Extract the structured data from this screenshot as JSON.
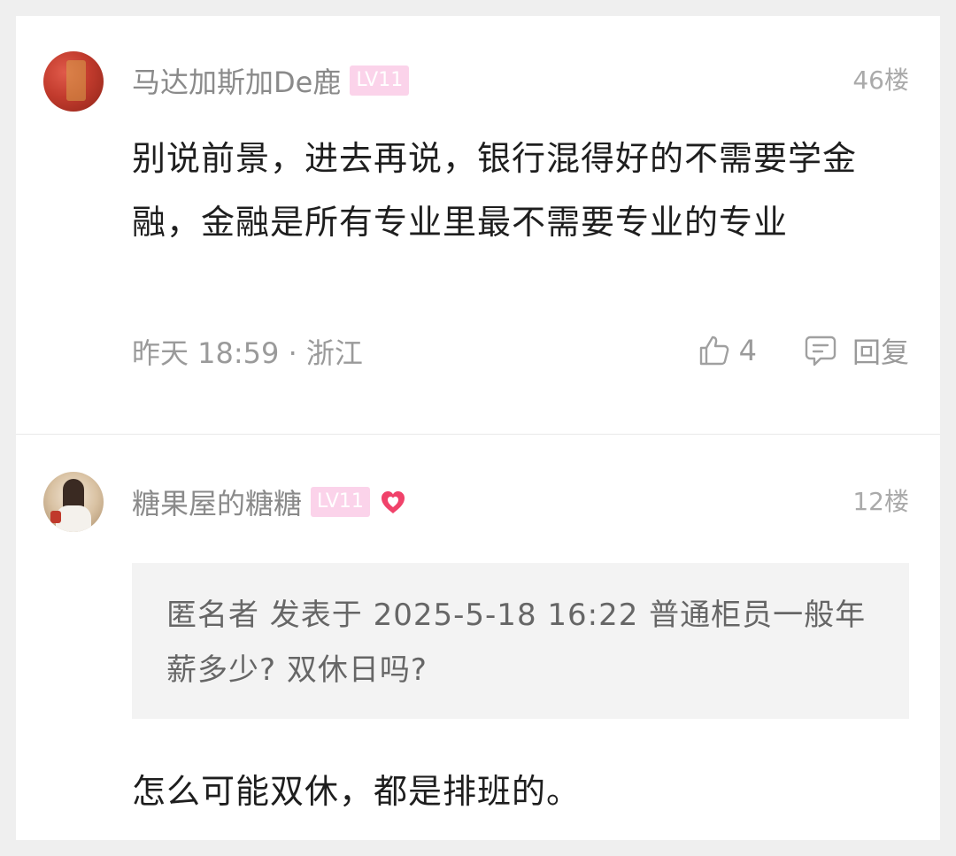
{
  "comments": [
    {
      "username": "马达加斯加De鹿",
      "level": "LV11",
      "floor": "46楼",
      "content": "别说前景，进去再说，银行混得好的不需要学金融，金融是所有专业里最不需要专业的专业",
      "meta": "昨天 18:59 · 浙江",
      "likes": "4",
      "reply_label": "回复",
      "icons": {
        "like": "thumbs-up-icon",
        "reply": "comment-bubble-icon"
      }
    },
    {
      "username": "糖果屋的糖糖",
      "level": "LV11",
      "badge_icon": "heart-badge-icon",
      "floor": "12楼",
      "quote": "匿名者 发表于 2025-5-18 16:22 普通柜员一般年薪多少? 双休日吗?",
      "content": "怎么可能双休，都是排班的。"
    }
  ],
  "colors": {
    "level_badge": "#fbd3ea",
    "heart": "#f0426a",
    "username": "#8a8a8a",
    "content": "#1e1e1e",
    "quote_bg": "#f3f3f3"
  }
}
